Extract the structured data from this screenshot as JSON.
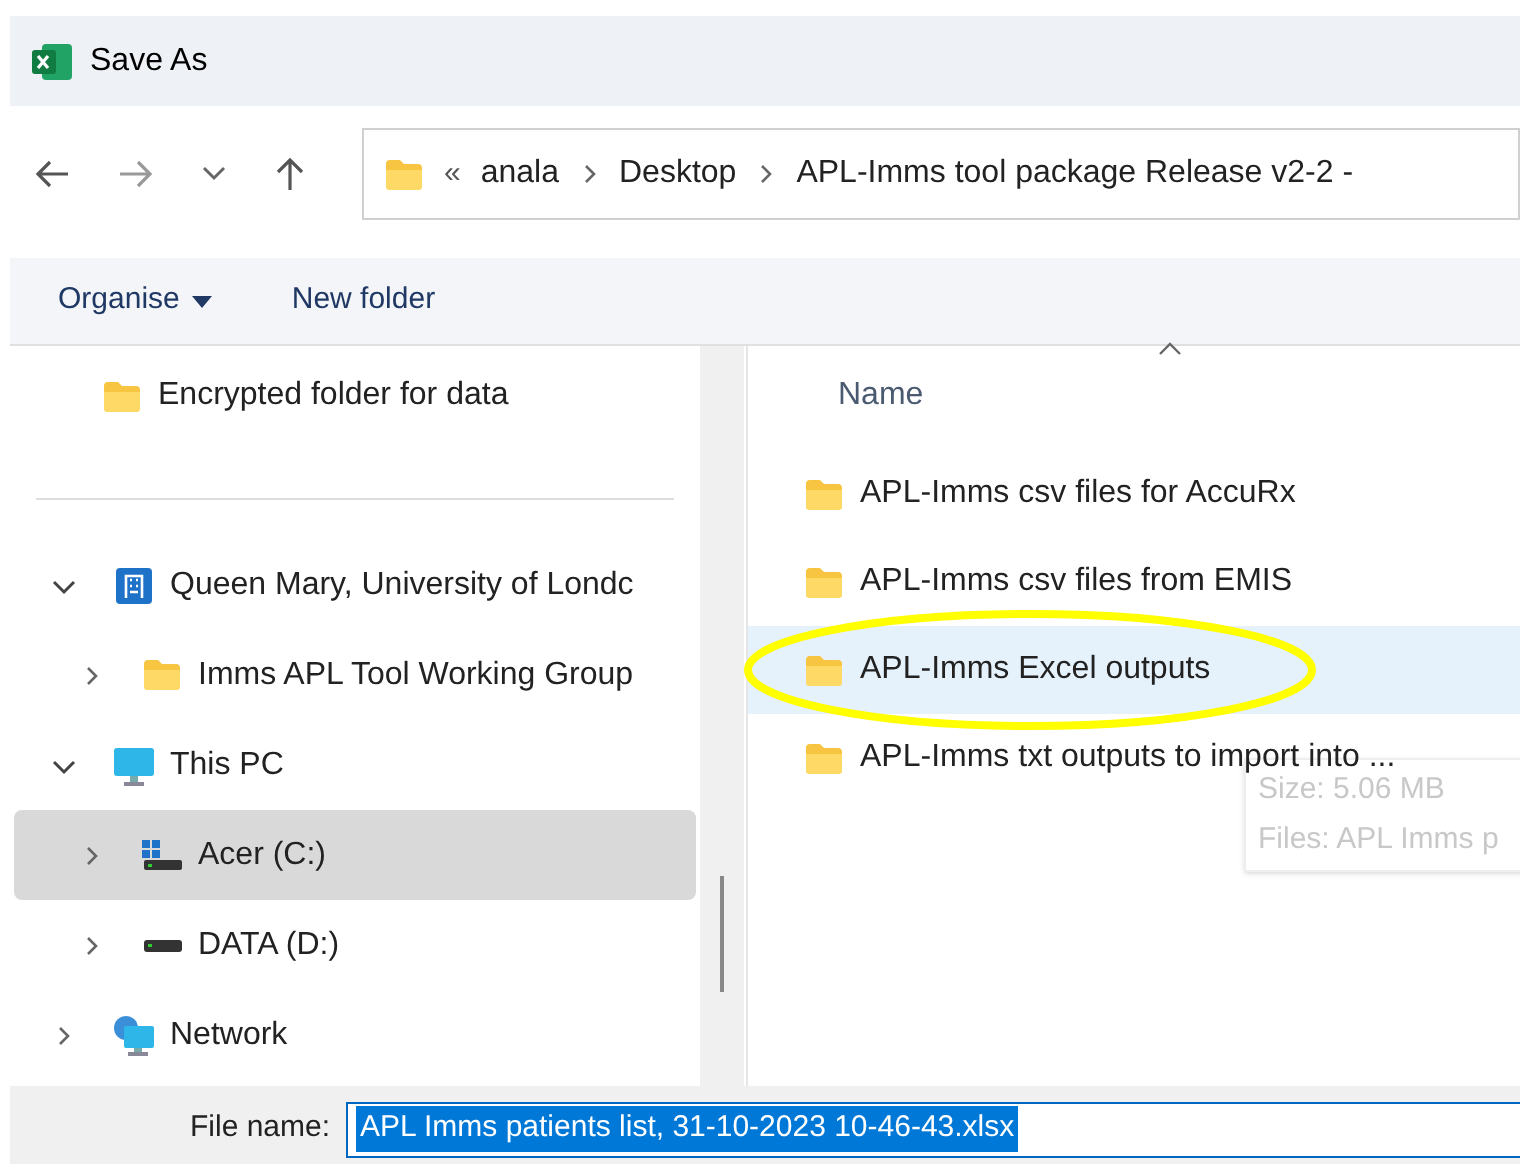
{
  "window": {
    "title": "Save As"
  },
  "address_bar": {
    "overflow": "«",
    "crumbs": [
      "anala",
      "Desktop",
      "APL-Imms tool package Release v2-2 -"
    ]
  },
  "toolbar": {
    "organise": "Organise",
    "new_folder": "New folder"
  },
  "nav_pane": {
    "top_item": {
      "label": "Encrypted folder for data"
    },
    "items": [
      {
        "label": "Queen Mary, University of Londc",
        "kind": "cloud",
        "expanded": true,
        "selected": false,
        "children": [
          {
            "label": "Imms APL Tool Working Group",
            "kind": "folder",
            "expanded": false,
            "selected": false
          }
        ]
      },
      {
        "label": "This PC",
        "kind": "pc",
        "expanded": true,
        "selected": false,
        "children": [
          {
            "label": "Acer (C:)",
            "kind": "system-drive",
            "expanded": false,
            "selected": true
          },
          {
            "label": "DATA (D:)",
            "kind": "drive",
            "expanded": false,
            "selected": false
          }
        ]
      },
      {
        "label": "Network",
        "kind": "network",
        "expanded": false,
        "selected": false
      }
    ]
  },
  "file_list": {
    "columns": [
      "Name"
    ],
    "rows": [
      {
        "name": "APL-Imms csv files for AccuRx",
        "selected": false,
        "circled": false
      },
      {
        "name": "APL-Imms csv files from EMIS",
        "selected": false,
        "circled": false
      },
      {
        "name": "APL-Imms Excel outputs",
        "selected": true,
        "circled": true
      },
      {
        "name": "APL-Imms txt outputs to import into ...",
        "selected": false,
        "circled": false
      }
    ],
    "tooltip": [
      "Size: 5.06 MB",
      "Files: APL Imms p"
    ]
  },
  "file_name": {
    "label": "File name:",
    "value": "APL Imms patients list, 31-10-2023 10-46-43.xlsx"
  }
}
